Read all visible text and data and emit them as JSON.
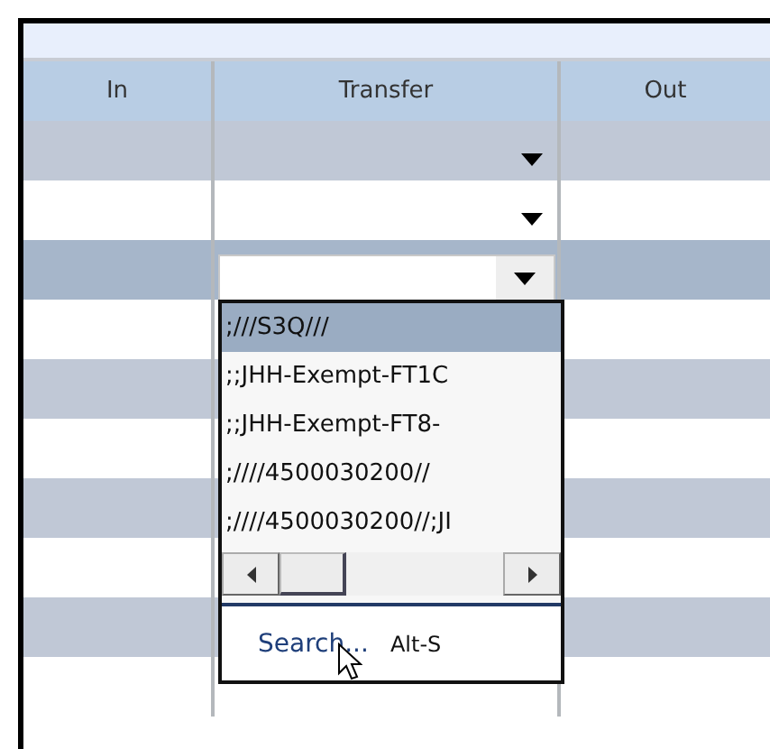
{
  "columns": [
    "In",
    "Transfer",
    "Out"
  ],
  "rows": [
    {
      "selected": false,
      "kind": "combo"
    },
    {
      "selected": false,
      "kind": "combo"
    },
    {
      "selected": true,
      "kind": "open"
    },
    {
      "selected": false,
      "kind": "empty"
    },
    {
      "selected": false,
      "kind": "empty"
    },
    {
      "selected": false,
      "kind": "empty"
    },
    {
      "selected": false,
      "kind": "empty"
    },
    {
      "selected": false,
      "kind": "empty"
    },
    {
      "selected": false,
      "kind": "empty"
    },
    {
      "selected": false,
      "kind": "empty"
    }
  ],
  "popup": {
    "items": [
      {
        "label": ";///S3Q///",
        "selected": true
      },
      {
        "label": ";;JHH-Exempt-FT1C",
        "selected": false
      },
      {
        "label": ";;JHH-Exempt-FT8-",
        "selected": false
      },
      {
        "label": ";////4500030200//",
        "selected": false
      },
      {
        "label": ";////4500030200//;JI",
        "selected": false
      }
    ],
    "scrollbar": {
      "level": 0.3
    },
    "search": {
      "label": "Search...",
      "shortcut": "Alt-S"
    }
  }
}
